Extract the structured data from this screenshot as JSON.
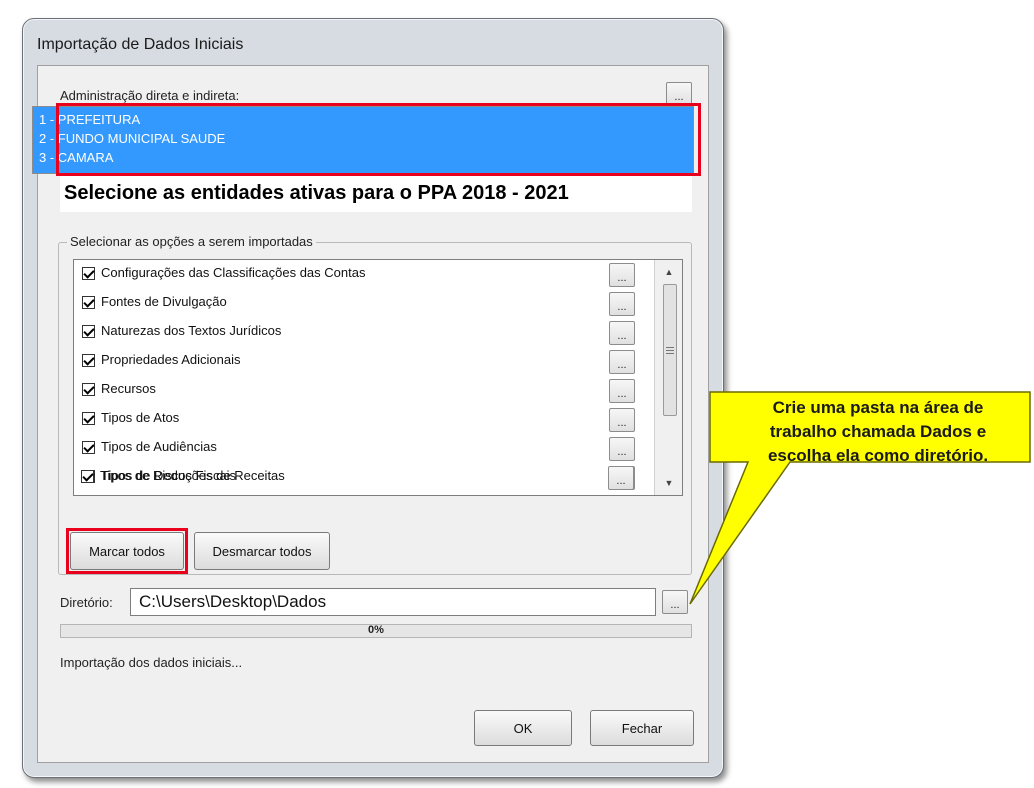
{
  "window": {
    "title": "Importação de Dados Iniciais"
  },
  "entities": {
    "label": "Administração direta e indireta:",
    "more_button": "...",
    "items": [
      "1 - PREFEITURA",
      "2 - FUNDO MUNICIPAL SAUDE",
      "3 - CAMARA"
    ]
  },
  "banner": "Selecione as entidades ativas para o PPA 2018 - 2021",
  "options": {
    "group_label": "Selecionar as opções a serem importadas",
    "items": [
      {
        "label": "Configurações das Classificações das Contas",
        "checked": true,
        "button": "..."
      },
      {
        "label": "Fontes de Divulgação",
        "checked": true,
        "button": "..."
      },
      {
        "label": "Naturezas dos Textos Jurídicos",
        "checked": true,
        "button": "..."
      },
      {
        "label": "Propriedades Adicionais",
        "checked": true,
        "button": "..."
      },
      {
        "label": "Recursos",
        "checked": true,
        "button": "..."
      },
      {
        "label": "Tipos de Atos",
        "checked": true,
        "button": "..."
      },
      {
        "label": "Tipos de Audiências",
        "checked": true,
        "button": "..."
      },
      {
        "label": "Tipos de Deduções de Receitas",
        "checked": true,
        "button": "..."
      },
      {
        "label": "Tipos de Riscos Fiscais",
        "checked": true,
        "button": "..."
      }
    ],
    "mark_all": "Marcar todos",
    "unmark_all": "Desmarcar todos"
  },
  "directory": {
    "label": "Diretório:",
    "value": "C:\\Users\\Desktop\\Dados",
    "browse": "..."
  },
  "progress": {
    "percent": 0,
    "text": "0%"
  },
  "status": "Importação dos dados iniciais...",
  "buttons": {
    "ok": "OK",
    "close": "Fechar"
  },
  "callout": {
    "lines": [
      "Crie uma pasta na área de",
      "trabalho chamada Dados e",
      "escolha ela como diretório."
    ],
    "color": "#ffff00"
  },
  "colors": {
    "selection": "#3399ff",
    "highlight": "#e8001c"
  }
}
